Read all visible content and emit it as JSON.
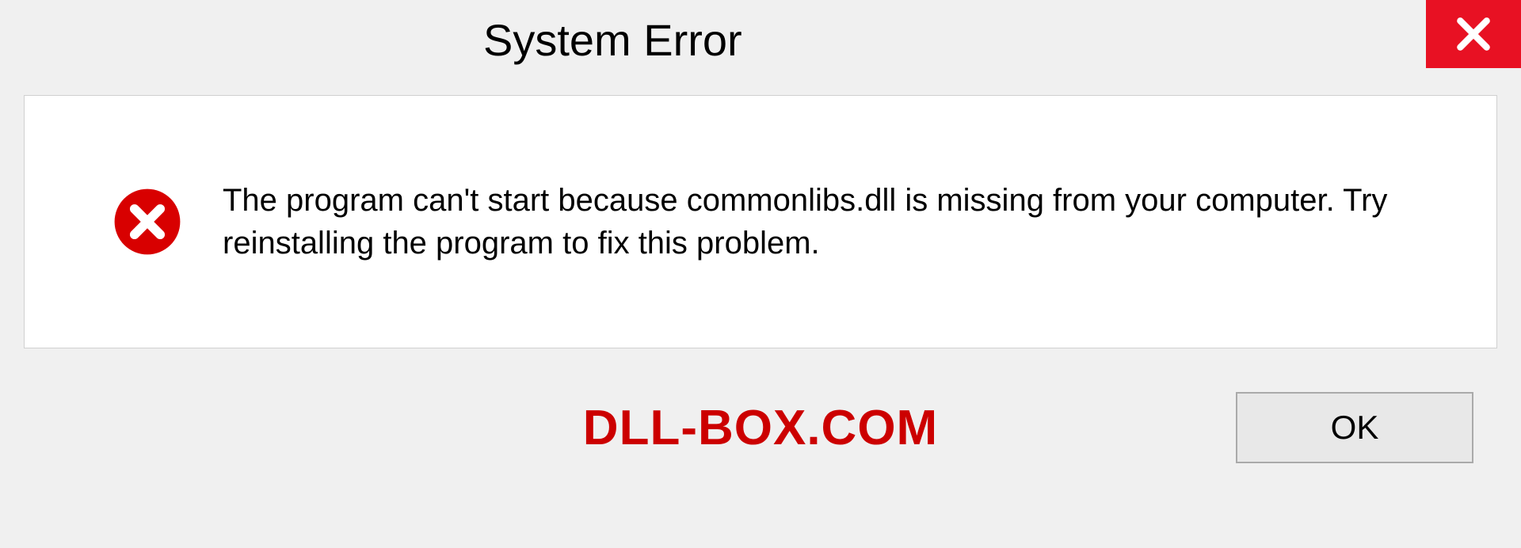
{
  "dialog": {
    "title": "System Error",
    "message": "The program can't start because commonlibs.dll is missing from your computer. Try reinstalling the program to fix this problem.",
    "ok_label": "OK"
  },
  "watermark": "DLL-BOX.COM",
  "colors": {
    "close_bg": "#e81123",
    "error_icon": "#d80000",
    "watermark": "#cc0000"
  }
}
